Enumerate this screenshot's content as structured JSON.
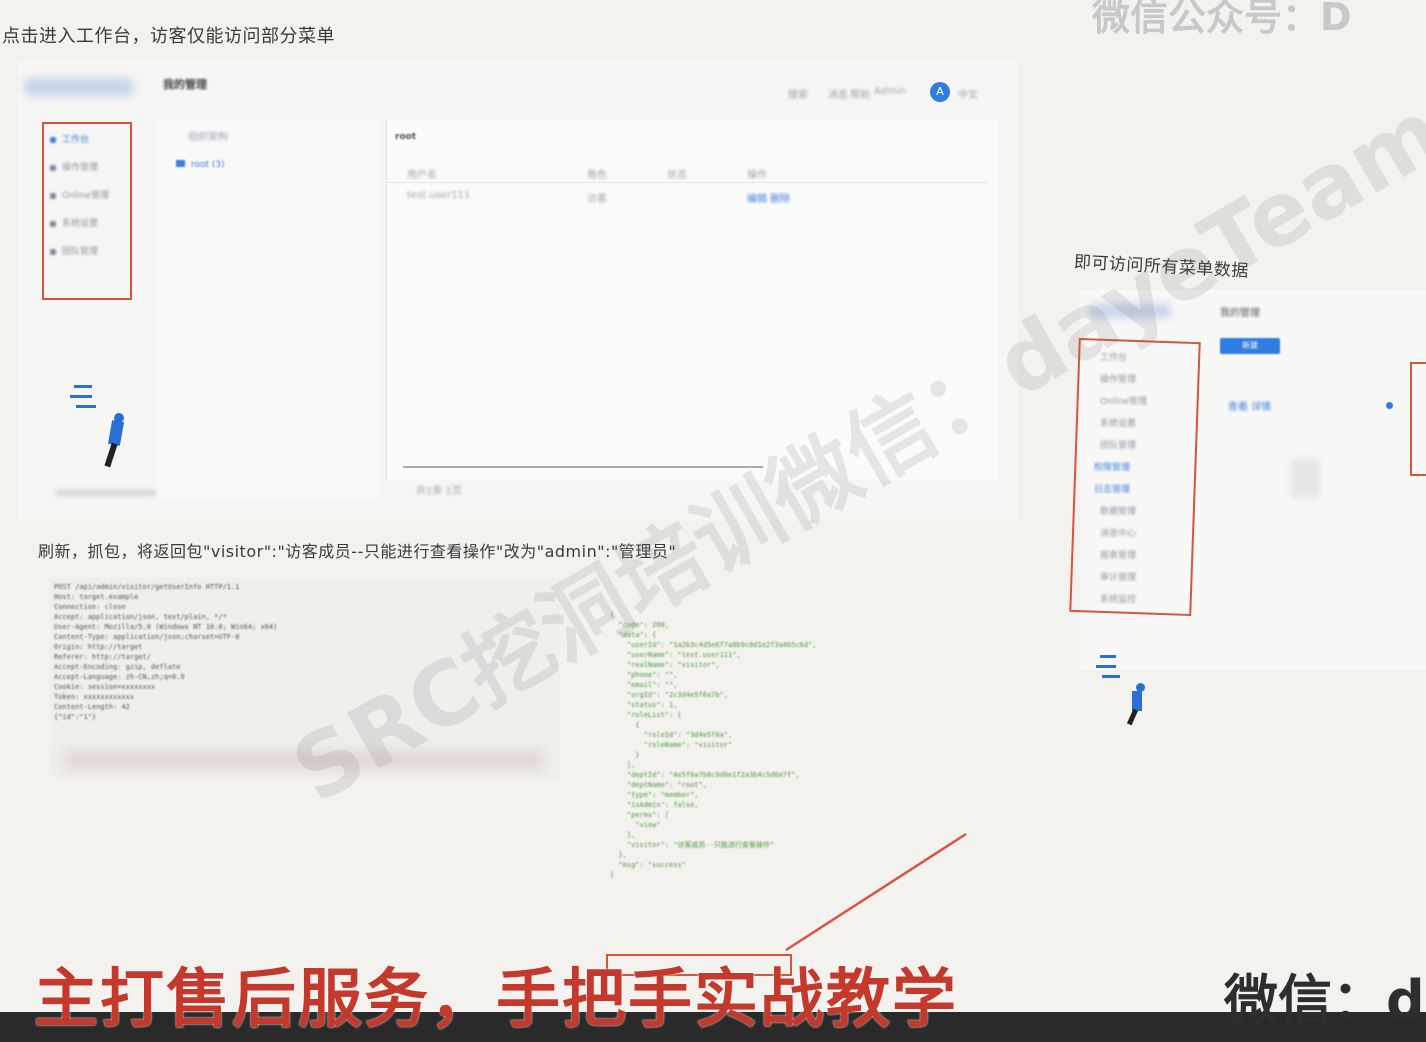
{
  "top_caption": "点击进入工作台，访客仅能访问部分菜单",
  "header_right_text": "微信公众号：D",
  "left_screenshot": {
    "app_logo_text": "",
    "page_heading": "我的管理",
    "sidebar_items": [
      "工作台",
      "操作管理",
      "Online管理",
      "系统设置",
      "团队管理"
    ],
    "tree_items": [
      "组织架构",
      "root (3)"
    ],
    "toolbar_items": [
      "搜索",
      "消息",
      "帮助",
      "Admin",
      "中文"
    ],
    "avatar_letter": "A",
    "table_title": "root",
    "table_headers": [
      "用户名",
      "角色",
      "状态",
      "操作"
    ],
    "table_row": [
      "test.user111",
      "访客",
      "编辑 删除"
    ],
    "pagination_text": "共1条  1页"
  },
  "right_caption": "即可访问所有菜单数据",
  "right_screenshot": {
    "heading": "我的管理",
    "button_label": "新建",
    "menu_items": [
      "工作台",
      "操作管理",
      "Online管理",
      "系统设置",
      "团队管理",
      "权限管理",
      "日志管理",
      "数据管理",
      "消息中心",
      "报表管理",
      "审计管理",
      "系统监控"
    ],
    "link_text": "查看 详情"
  },
  "middle_caption": "刷新，抓包，将返回包\"visitor\":\"访客成员--只能进行查看操作\"改为\"admin\":\"管理员\"",
  "request_lines": [
    "POST /api/admin/visitor/getUserInfo HTTP/1.1",
    "Host: target.example",
    "Connection: close",
    "Accept: application/json, text/plain, */*",
    "User-Agent: Mozilla/5.0 (Windows NT 10.0; Win64; x64)",
    "Content-Type: application/json;charset=UTF-8",
    "Origin: http://target",
    "Referer: http://target/",
    "Accept-Encoding: gzip, deflate",
    "Accept-Language: zh-CN,zh;q=0.9",
    "Cookie: session=xxxxxxxx",
    "Token: xxxxxxxxxxxx",
    "Content-Length: 42",
    "",
    "{\"id\":\"1\"}"
  ],
  "response_lines": [
    "{",
    "  \"code\": 200,",
    "  \"data\": {",
    "    \"userId\": \"1a2b3c4d5e6f7a8b9c0d1e2f3a4b5c6d\",",
    "    \"userName\": \"test.user111\",",
    "    \"realName\": \"visitor\",",
    "    \"phone\": \"\",",
    "    \"email\": \"\",",
    "    \"orgId\": \"2c3d4e5f6a7b\",",
    "    \"status\": 1,",
    "    \"roleList\": [",
    "      {",
    "        \"roleId\": \"3d4e5f6a\",",
    "        \"roleName\": \"visitor\"",
    "      }",
    "    ],",
    "    \"deptId\": \"4e5f6a7b8c9d0e1f2a3b4c5d6e7f\",",
    "    \"deptName\": \"root\",",
    "    \"type\": \"member\",",
    "    \"isAdmin\": false,",
    "    \"perms\": [",
    "      \"view\"",
    "    ],",
    "    \"visitor\": \"访客成员--只能进行查看操作\"",
    "  },",
    "  \"msg\": \"success\"",
    "}"
  ],
  "bottom_banner": "主打售后服务，手把手实战教学",
  "bottom_right_text": "微信：d",
  "watermark_text": "SRC挖洞培训微信：dayeTeam",
  "colors": {
    "red": "#d9533f",
    "blue": "#3b7ddd",
    "green": "#4a9a3a",
    "banner_red": "#c4392b"
  }
}
